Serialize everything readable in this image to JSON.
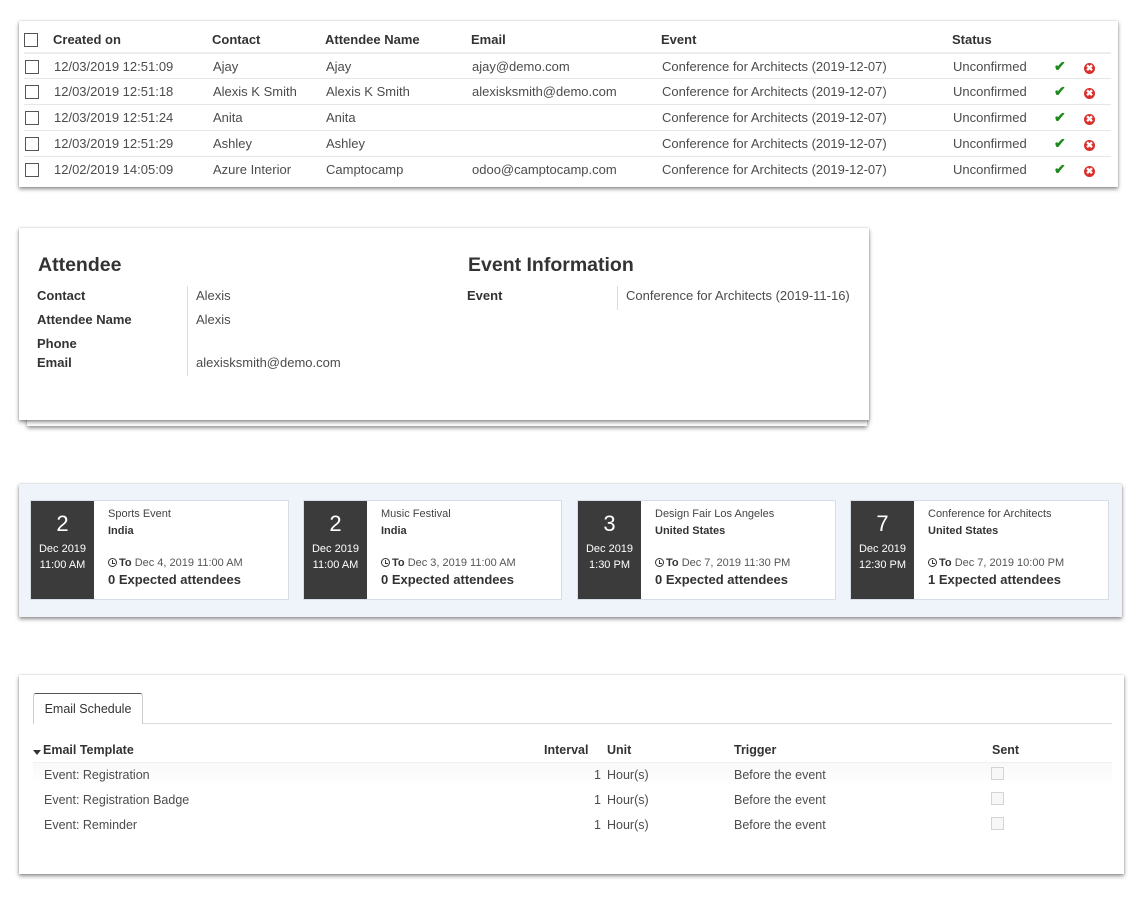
{
  "attendee_list": {
    "columns": [
      "Created on",
      "Contact",
      "Attendee Name",
      "Email",
      "Event",
      "Status"
    ],
    "rows": [
      {
        "created_on": "12/03/2019 12:51:09",
        "contact": "Ajay",
        "attendee_name": "Ajay",
        "email": "ajay@demo.com",
        "event": "Conference for Architects (2019-12-07)",
        "status": "Unconfirmed"
      },
      {
        "created_on": "12/03/2019 12:51:18",
        "contact": "Alexis K Smith",
        "attendee_name": "Alexis K Smith",
        "email": "alexisksmith@demo.com",
        "event": "Conference for Architects (2019-12-07)",
        "status": "Unconfirmed"
      },
      {
        "created_on": "12/03/2019 12:51:24",
        "contact": "Anita",
        "attendee_name": "Anita",
        "email": "",
        "event": "Conference for Architects (2019-12-07)",
        "status": "Unconfirmed"
      },
      {
        "created_on": "12/03/2019 12:51:29",
        "contact": "Ashley",
        "attendee_name": "Ashley",
        "email": "",
        "event": "Conference for Architects (2019-12-07)",
        "status": "Unconfirmed"
      },
      {
        "created_on": "12/02/2019 14:05:09",
        "contact": "Azure Interior",
        "attendee_name": "Camptocamp",
        "email": "odoo@camptocamp.com",
        "event": "Conference for Architects (2019-12-07)",
        "status": "Unconfirmed"
      }
    ],
    "icons": {
      "confirm": "✔",
      "cancel": "✖"
    },
    "colors": {
      "confirm": "#1e8a1e",
      "cancel": "#d9302c"
    }
  },
  "attendee_form": {
    "attendee_title": "Attendee",
    "event_title": "Event Information",
    "fields": {
      "contact_label": "Contact",
      "contact_value": "Alexis",
      "attendee_name_label": "Attendee Name",
      "attendee_name_value": "Alexis",
      "phone_label": "Phone",
      "phone_value": "",
      "email_label": "Email",
      "email_value": "alexisksmith@demo.com",
      "event_label": "Event",
      "event_value": "Conference for Architects (2019-11-16)"
    }
  },
  "event_cards": [
    {
      "day": "2",
      "month_year": "Dec 2019",
      "time": "11:00 AM",
      "name": "Sports Event",
      "country": "India",
      "to_label": "To",
      "to_date": "Dec 4, 2019 11:00 AM",
      "expected": "0 Expected attendees"
    },
    {
      "day": "2",
      "month_year": "Dec 2019",
      "time": "11:00 AM",
      "name": "Music Festival",
      "country": "India",
      "to_label": "To",
      "to_date": "Dec 3, 2019 11:00 AM",
      "expected": "0 Expected attendees"
    },
    {
      "day": "3",
      "month_year": "Dec 2019",
      "time": "1:30 PM",
      "name": "Design Fair Los Angeles",
      "country": "United States",
      "to_label": "To",
      "to_date": "Dec 7, 2019 11:30 PM",
      "expected": "0 Expected attendees"
    },
    {
      "day": "7",
      "month_year": "Dec 2019",
      "time": "12:30 PM",
      "name": "Conference for Architects",
      "country": "United States",
      "to_label": "To",
      "to_date": "Dec 7, 2019 10:00 PM",
      "expected": "1 Expected attendees"
    }
  ],
  "email_schedule": {
    "tab_label": "Email Schedule",
    "columns": {
      "template": "Email Template",
      "interval": "Interval",
      "unit": "Unit",
      "trigger": "Trigger",
      "sent": "Sent"
    },
    "rows": [
      {
        "template": "Event: Registration",
        "interval": "1",
        "unit": "Hour(s)",
        "trigger": "Before the event",
        "sent": false
      },
      {
        "template": "Event: Registration Badge",
        "interval": "1",
        "unit": "Hour(s)",
        "trigger": "Before the event",
        "sent": false
      },
      {
        "template": "Event: Reminder",
        "interval": "1",
        "unit": "Hour(s)",
        "trigger": "Before the event",
        "sent": false
      }
    ]
  }
}
